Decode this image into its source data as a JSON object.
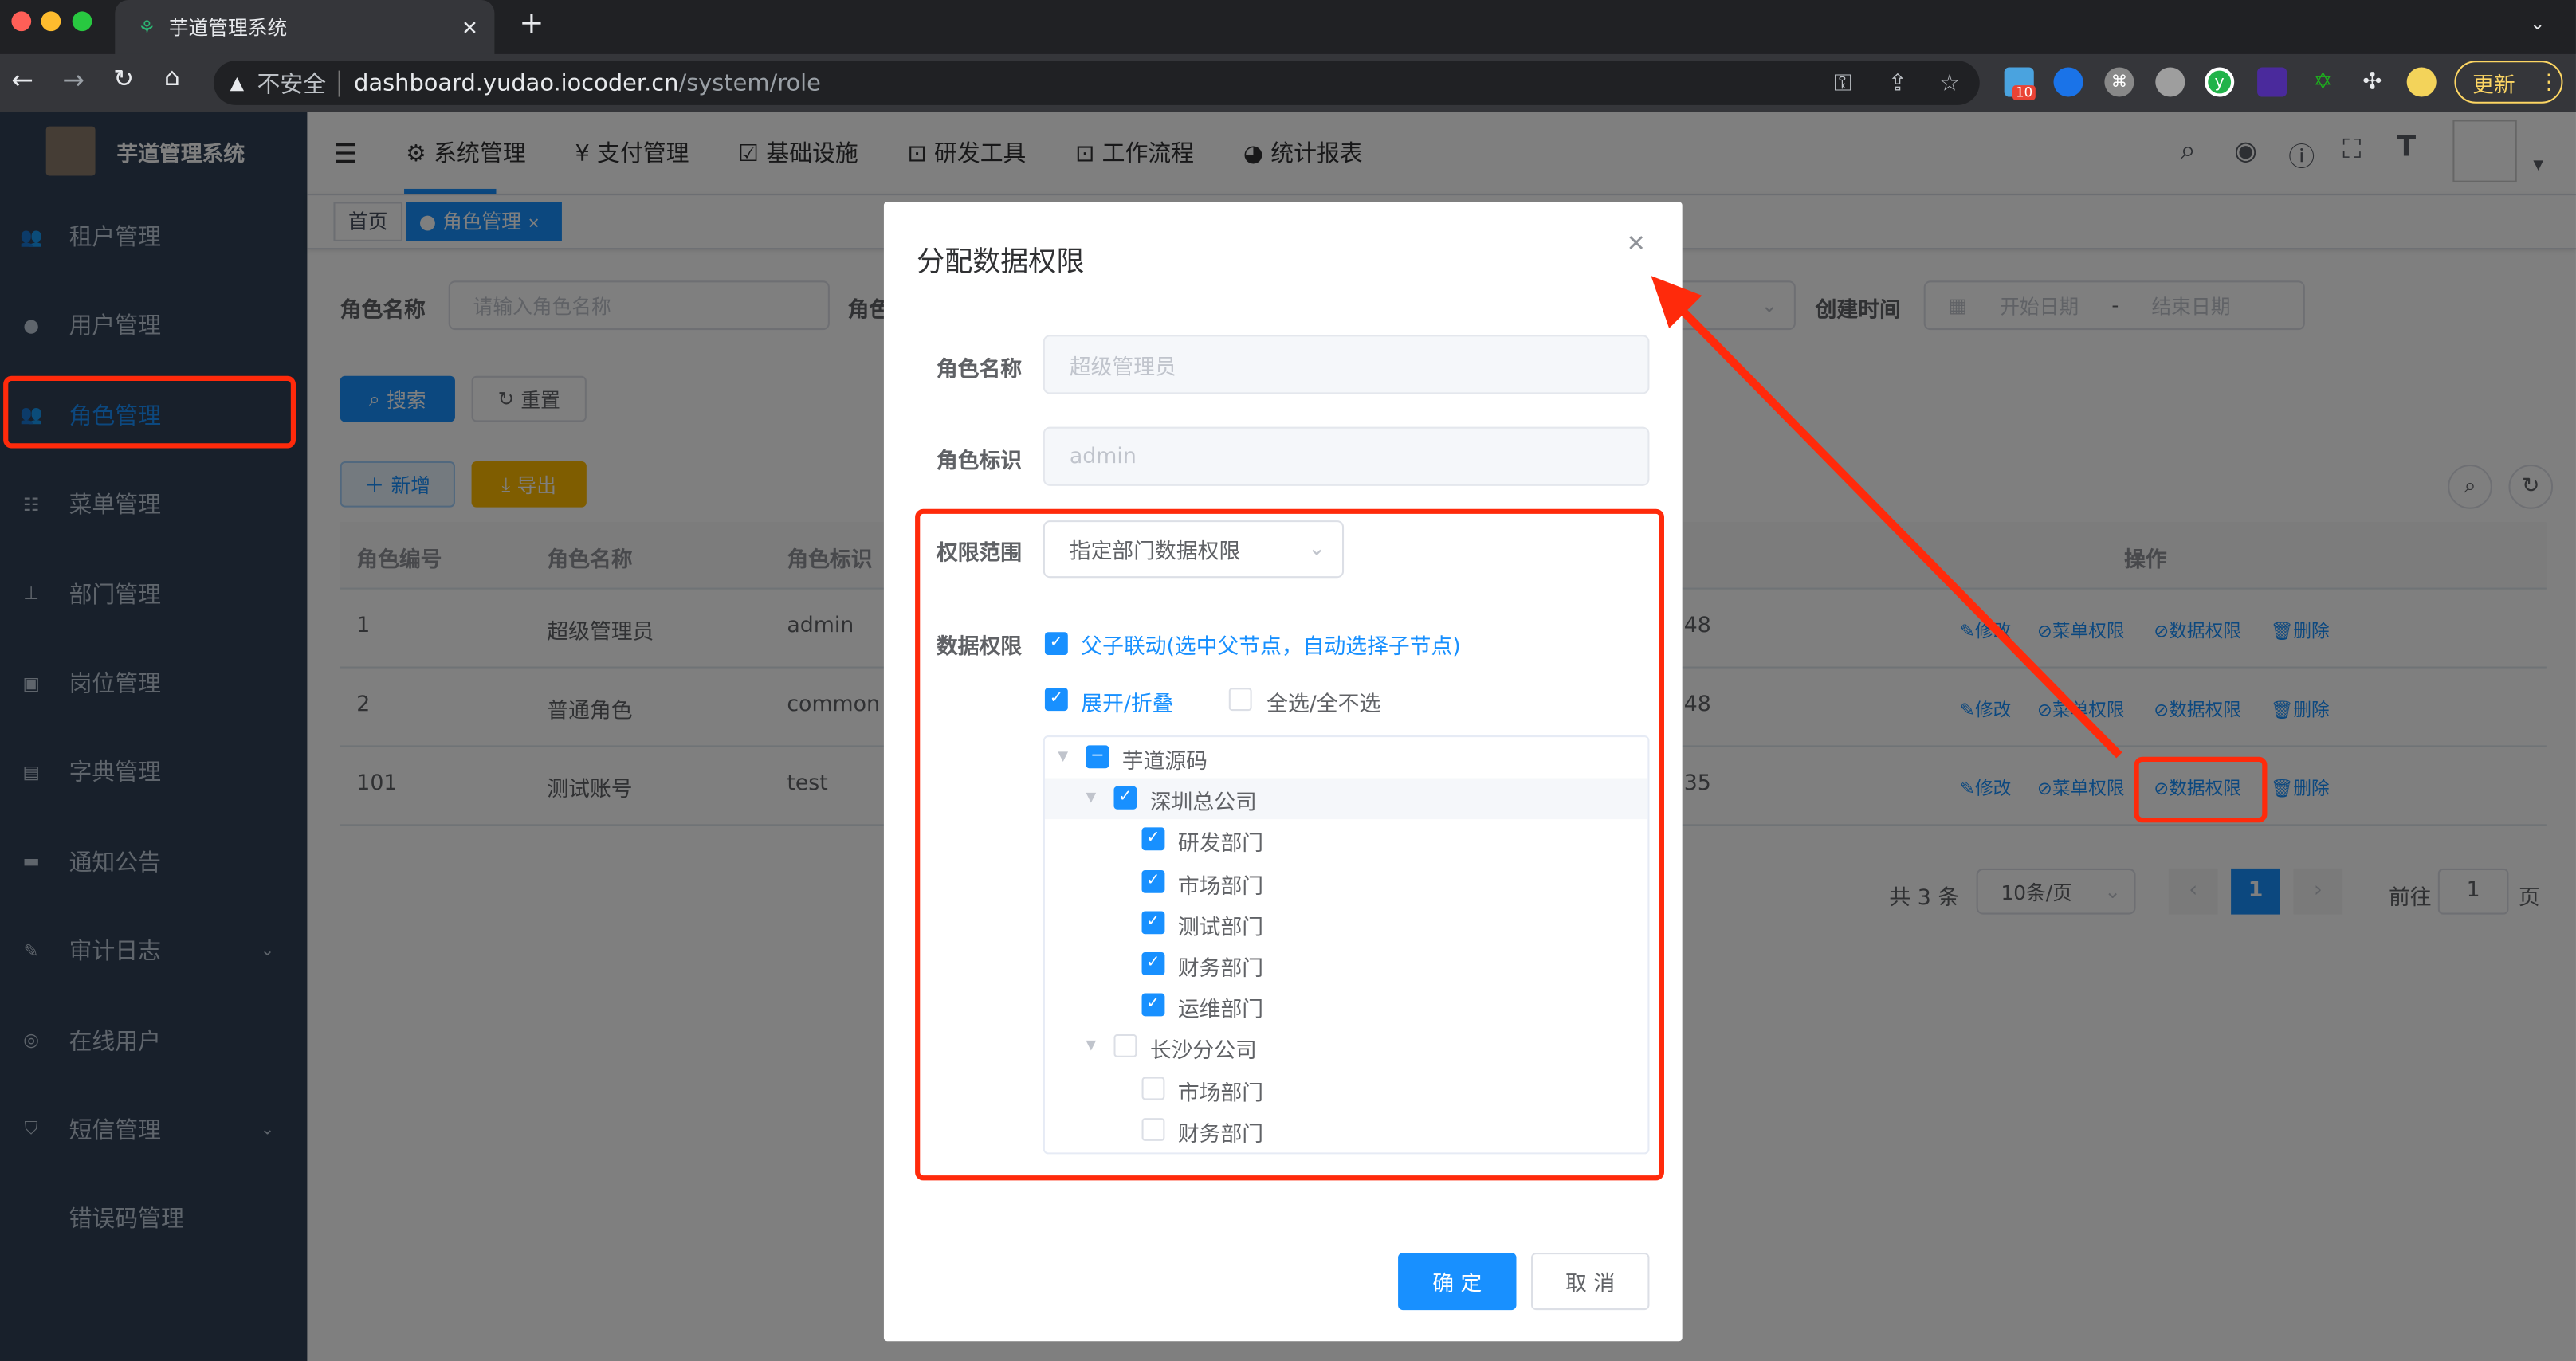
{
  "browser": {
    "tab_title": "芋道管理系统",
    "url_security": "不安全",
    "url_host": "dashboard.yudao.iocoder.cn",
    "url_path": "/system/role",
    "update_label": "更新",
    "ext_badge": "10"
  },
  "sidebar": {
    "title": "芋道管理系统",
    "items": [
      {
        "label": "租户管理",
        "icon": "peoples-icon"
      },
      {
        "label": "用户管理",
        "icon": "user-icon"
      },
      {
        "label": "角色管理",
        "icon": "peoples-icon",
        "active": true
      },
      {
        "label": "菜单管理",
        "icon": "tree-table-icon"
      },
      {
        "label": "部门管理",
        "icon": "tree-icon"
      },
      {
        "label": "岗位管理",
        "icon": "post-icon"
      },
      {
        "label": "字典管理",
        "icon": "dict-icon"
      },
      {
        "label": "通知公告",
        "icon": "message-icon"
      },
      {
        "label": "审计日志",
        "icon": "log-icon",
        "expandable": true
      },
      {
        "label": "在线用户",
        "icon": "online-icon"
      },
      {
        "label": "短信管理",
        "icon": "shield-icon",
        "expandable": true
      },
      {
        "label": "错误码管理",
        "icon": "code-icon"
      }
    ]
  },
  "topnav": [
    "系统管理",
    "支付管理",
    "基础设施",
    "研发工具",
    "工作流程",
    "统计报表"
  ],
  "tags": {
    "home": "首页",
    "current": "角色管理"
  },
  "search": {
    "name_label": "角色名称",
    "name_placeholder": "请输入角色名称",
    "code_label_partial": "角色",
    "created_label": "创建时间",
    "start_placeholder": "开始日期",
    "range_sep": "-",
    "end_placeholder": "结束日期",
    "search_btn": "搜索",
    "reset_btn": "重置",
    "add_btn": "新增",
    "export_btn": "导出"
  },
  "table": {
    "headers": [
      "角色编号",
      "角色名称",
      "角色标识",
      "操作"
    ],
    "rows": [
      {
        "id": "1",
        "name": "超级管理员",
        "code": "admin",
        "time_tail": "48"
      },
      {
        "id": "2",
        "name": "普通角色",
        "code": "common",
        "time_tail": "48"
      },
      {
        "id": "101",
        "name": "测试账号",
        "code": "test",
        "time_tail": "35"
      }
    ],
    "actions": [
      "修改",
      "菜单权限",
      "数据权限",
      "删除"
    ]
  },
  "pagination": {
    "total": "共 3 条",
    "page_size": "10条/页",
    "current": "1",
    "goto_label": "前往",
    "goto_value": "1",
    "page_suffix": "页"
  },
  "dialog": {
    "title": "分配数据权限",
    "role_name_label": "角色名称",
    "role_name_value": "超级管理员",
    "role_key_label": "角色标识",
    "role_key_value": "admin",
    "scope_label": "权限范围",
    "scope_value": "指定部门数据权限",
    "data_label": "数据权限",
    "linkage_label": "父子联动(选中父节点，自动选择子节点)",
    "expand_label": "展开/折叠",
    "select_all_label": "全选/全不选",
    "tree": [
      {
        "label": "芋道源码",
        "state": "indeterminate",
        "level": 0,
        "expanded": true
      },
      {
        "label": "深圳总公司",
        "state": "checked",
        "level": 1,
        "expanded": true
      },
      {
        "label": "研发部门",
        "state": "checked",
        "level": 2
      },
      {
        "label": "市场部门",
        "state": "checked",
        "level": 2
      },
      {
        "label": "测试部门",
        "state": "checked",
        "level": 2
      },
      {
        "label": "财务部门",
        "state": "checked",
        "level": 2
      },
      {
        "label": "运维部门",
        "state": "checked",
        "level": 2
      },
      {
        "label": "长沙分公司",
        "state": "unchecked",
        "level": 1,
        "expanded": true
      },
      {
        "label": "市场部门",
        "state": "unchecked",
        "level": 2
      },
      {
        "label": "财务部门",
        "state": "unchecked",
        "level": 2
      }
    ],
    "confirm": "确 定",
    "cancel": "取 消"
  },
  "colors": {
    "primary": "#1890ff",
    "sidebar_bg": "#304156",
    "annotation_red": "#ff2a0b",
    "export": "#ffba00"
  }
}
